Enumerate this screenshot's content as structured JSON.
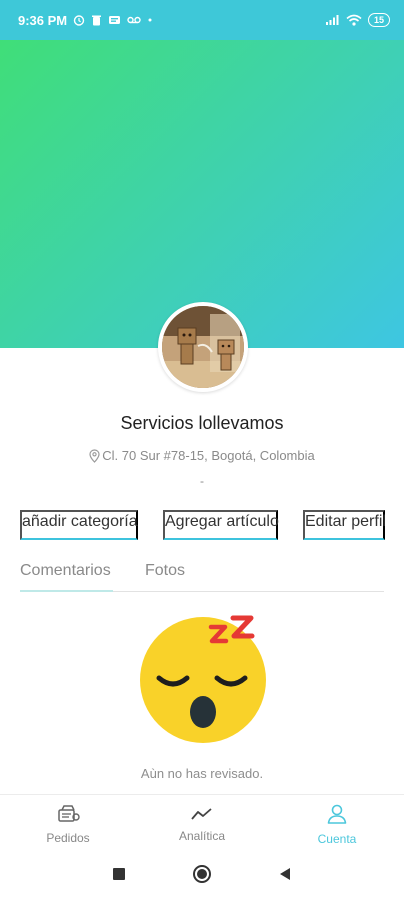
{
  "status_bar": {
    "time": "9:36 PM",
    "battery": "15",
    "icons_left": [
      "alarm-icon",
      "trash-icon",
      "notification-icon",
      "voicemail-icon",
      "dot-icon"
    ],
    "icons_right": [
      "signal-icon",
      "wifi-icon",
      "battery-icon"
    ]
  },
  "colors": {
    "gradient_start": "#40de78",
    "gradient_end": "#3ec6e2",
    "accent": "#3ec3dd",
    "active_nav": "#4cc7dc"
  },
  "profile": {
    "name": "Servicios lollevamos",
    "address": "Cl. 70 Sur #78-15, Bogotá, Colombia",
    "extra": "-"
  },
  "actions": {
    "add_category": "añadir categoría",
    "add_item": "Agregar artículo",
    "edit_profile": "Editar perfil"
  },
  "tabs": [
    {
      "label": "Comentarios",
      "active": true
    },
    {
      "label": "Fotos",
      "active": false
    }
  ],
  "empty_state": {
    "icon": "sleeping-emoji-icon",
    "message": "Aùn no has revisado."
  },
  "bottom_nav": [
    {
      "label": "Pedidos",
      "icon": "orders-icon",
      "active": false
    },
    {
      "label": "Analítica",
      "icon": "analytics-icon",
      "active": false
    },
    {
      "label": "Cuenta",
      "icon": "account-icon",
      "active": true
    }
  ],
  "system_nav": [
    "recents-button",
    "home-button",
    "back-button"
  ]
}
